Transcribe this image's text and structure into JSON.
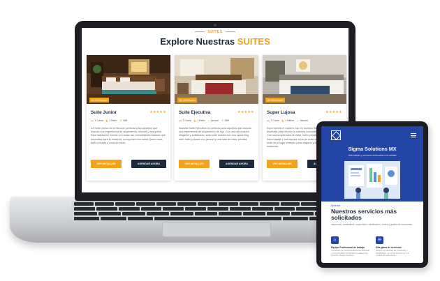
{
  "website": {
    "kicker": "SUITES",
    "title_main": "Explore Nuestras",
    "title_accent": "SUITES",
    "rooms": [
      {
        "price": "$1.200/Noche",
        "name": "Suite Junior",
        "stars": "★★★★★",
        "amenities": [
          "1 Cama",
          "1 Baño",
          "Wifi"
        ],
        "description": "La Suite Junior es la elección perfecta para aquellos que buscan una experiencia de alojamiento cómoda y asequible. Esta habitación cuenta con todas las comodidades básicas que necesitas para tu estancia, incluyendo una cama Queen size, baño privado y zona de estar.",
        "btn_details": "VER DETALLES",
        "btn_book": "AGENDAR AHORA"
      },
      {
        "price": "$1.180/Noche",
        "name": "Suite Ejecutiva",
        "stars": "★★★★★",
        "amenities": [
          "1 Cama",
          "1 Baño",
          "Jacuzzi",
          "Wifi"
        ],
        "description": "Nuestra Suite Ejecutiva es perfecta para aquellos que buscan una experiencia de alojamiento de lujo. Con una decoración elegante y sofisticada, esta suite cuenta con una cama king size, baño privado con jacuzzi y una sala de estar privada.",
        "btn_details": "VER DETALLES",
        "btn_book": "AGENDAR AHORA"
      },
      {
        "price": "$2.500/Noche",
        "name": "Super Lujosa",
        "stars": "★★★★★",
        "amenities": [
          "1 Cama",
          "2 Baños",
          "Jacuzzi"
        ],
        "description": "Experimenta el máximo lujo en nuestra Suite Super Lujosa, diseñada para ofrecer la máxima comodidad y exclusividad. Con una amplia sala de estar, baño privado con bañera de hidromasaje y una amplia zona de estar con vistas al mar, esta suite es el lugar perfecto para relajarte y disfrutar de sus estancias.",
        "btn_details": "VER DETALLES",
        "btn_book": "AGENDAR AHORA"
      }
    ]
  },
  "tablet": {
    "brand": "Sigma Solutions MX",
    "tagline": "Actividades y servicios enfocados a la calidad",
    "kicker": "Servicios",
    "heading": "Nuestros servicios más solicitados",
    "intro": "Inspección, rendimiento, supervisión, clasificación, control y gestión de soluciones.",
    "services": [
      {
        "title": "Equipo Profesional de trabajo",
        "desc": "Contamos con personal altamente calificado y comprometido con brindar la calidad que nuestros clientes merecen."
      },
      {
        "title": "Alta gama de servicios",
        "desc": "Ofrecemos servicios de inspección y clasificación, así como soluciones a la medida de cada cliente."
      }
    ]
  },
  "colors": {
    "accent": "#f2a31b",
    "navy": "#1c2a3d",
    "tablet_blue": "#2346a6"
  }
}
